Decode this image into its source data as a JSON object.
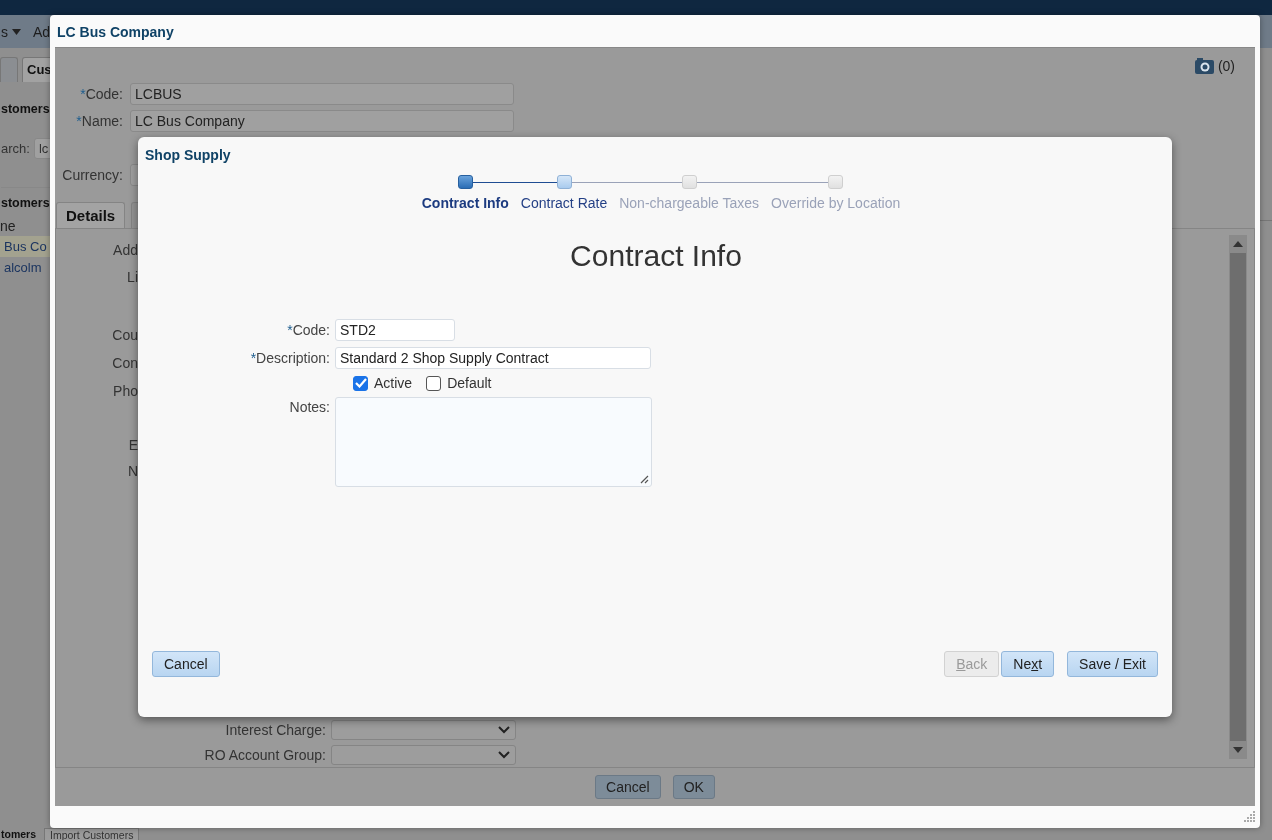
{
  "app": {
    "menu": [
      {
        "label": "s"
      },
      {
        "label": "Ad"
      }
    ],
    "tabs": [
      {
        "selected": false
      },
      {
        "label": "Cus",
        "selected": true
      }
    ],
    "sidebar": {
      "heading": "stomers",
      "search_label": "arch:",
      "search_value": "lc",
      "list_heading": "stomers",
      "column": "ne",
      "rows": [
        {
          "text": "Bus Co",
          "selected": true
        },
        {
          "text": "alcolm",
          "selected": false
        }
      ]
    },
    "bottom_tabs": [
      {
        "label": "tomers",
        "selected": true
      },
      {
        "label": "Import Customers",
        "selected": false
      }
    ]
  },
  "customer_dialog": {
    "title": "LC Bus Company",
    "attachments": "(0)",
    "fields": [
      {
        "mark": "*",
        "label": "Code:",
        "value": "LCBUS"
      },
      {
        "mark": "*",
        "label": "Name:",
        "value": "LC Bus Company"
      },
      {
        "label": "Currency:"
      }
    ],
    "tabs": [
      {
        "label": "Details",
        "selected": true
      },
      {
        "selected": false
      }
    ],
    "detail_labels": [
      "Add",
      "Li",
      "Cou",
      "Con",
      "Pho",
      "E",
      "N"
    ],
    "selects": [
      {
        "label": "Interest Charge:"
      },
      {
        "label": "RO Account Group:"
      }
    ],
    "buttons": [
      "Cancel",
      "OK"
    ]
  },
  "supply_dialog": {
    "title": "Shop Supply",
    "steps": [
      {
        "label": "Contract Info",
        "selected": true,
        "disabled": false
      },
      {
        "label": "Contract Rate",
        "selected": false,
        "disabled": false
      },
      {
        "label": "Non-chargeable Taxes",
        "selected": false,
        "disabled": true
      },
      {
        "label": "Override by Location",
        "selected": false,
        "disabled": true
      }
    ],
    "heading": "Contract Info",
    "fields": [
      {
        "kind": "text",
        "mark": "*",
        "label": "Code:",
        "value": "STD2"
      },
      {
        "kind": "text",
        "mark": "*",
        "label": "Description:",
        "value": "Standard 2 Shop Supply Contract"
      },
      {
        "kind": "checks",
        "options": [
          {
            "label": "Active",
            "checked": true
          },
          {
            "label": "Default",
            "checked": false
          }
        ]
      },
      {
        "kind": "textarea",
        "label": "Notes:"
      }
    ],
    "left_buttons": [
      {
        "after": "Cancel",
        "disabled": false
      }
    ],
    "right_buttons": [
      {
        "key": "B",
        "after": "ack",
        "disabled": true
      },
      {
        "before": "Ne",
        "key": "x",
        "after": "t",
        "disabled": false
      },
      {
        "after": "Save / Exit",
        "disabled": false
      }
    ]
  }
}
